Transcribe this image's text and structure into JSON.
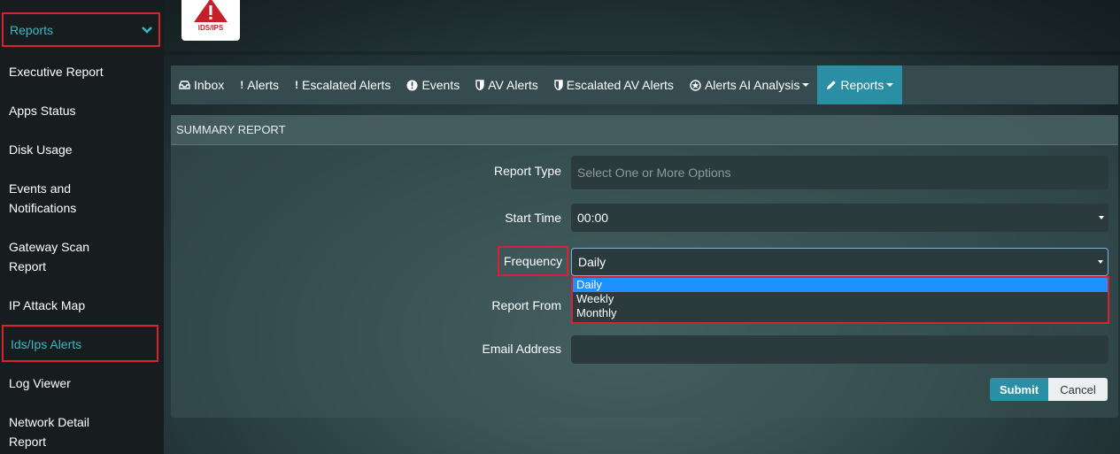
{
  "sidebar": {
    "reports_label": "Reports",
    "items": [
      {
        "label_lines": [
          "Executive Report"
        ]
      },
      {
        "label_lines": [
          "Apps Status"
        ]
      },
      {
        "label_lines": [
          "Disk Usage"
        ]
      },
      {
        "label_lines": [
          "Events and",
          "Notifications"
        ]
      },
      {
        "label_lines": [
          "Gateway Scan",
          "Report"
        ]
      },
      {
        "label_lines": [
          "IP Attack Map"
        ]
      },
      {
        "label_lines": [
          "Ids/Ips Alerts"
        ]
      },
      {
        "label_lines": [
          "Log Viewer"
        ]
      },
      {
        "label_lines": [
          "Network Detail",
          "Report"
        ]
      }
    ],
    "active_color": "#3eb7c0"
  },
  "logo": {
    "text": "IDS/IPS",
    "icon": "warning-triangle-icon",
    "color": "#c3202b"
  },
  "nav": {
    "tabs": [
      {
        "label": "Inbox",
        "icon": "inbox-icon"
      },
      {
        "label": "Alerts",
        "icon": "exclamation-icon"
      },
      {
        "label": "Escalated Alerts",
        "icon": "exclamation-icon"
      },
      {
        "label": "Events",
        "icon": "exclamation-circle-icon"
      },
      {
        "label": "AV Alerts",
        "icon": "shield-icon"
      },
      {
        "label": "Escalated AV Alerts",
        "icon": "shield-icon"
      },
      {
        "label": "Alerts AI Analysis",
        "icon": "gear-badge-icon"
      },
      {
        "label": "Reports",
        "icon": "pencil-icon"
      }
    ],
    "active_color": "#2a8fa4"
  },
  "panel": {
    "title": "SUMMARY REPORT",
    "report_type": {
      "label": "Report Type",
      "placeholder": "Select One or More Options"
    },
    "start_time": {
      "label": "Start Time",
      "value": "00:00"
    },
    "frequency": {
      "label": "Frequency",
      "value": "Daily",
      "options": [
        "Daily",
        "Weekly",
        "Monthly"
      ]
    },
    "report_from": {
      "label": "Report From"
    },
    "email": {
      "label": "Email Address",
      "value": ""
    },
    "submit_label": "Submit",
    "cancel_label": "Cancel"
  },
  "highlight_color": "#d8232f"
}
